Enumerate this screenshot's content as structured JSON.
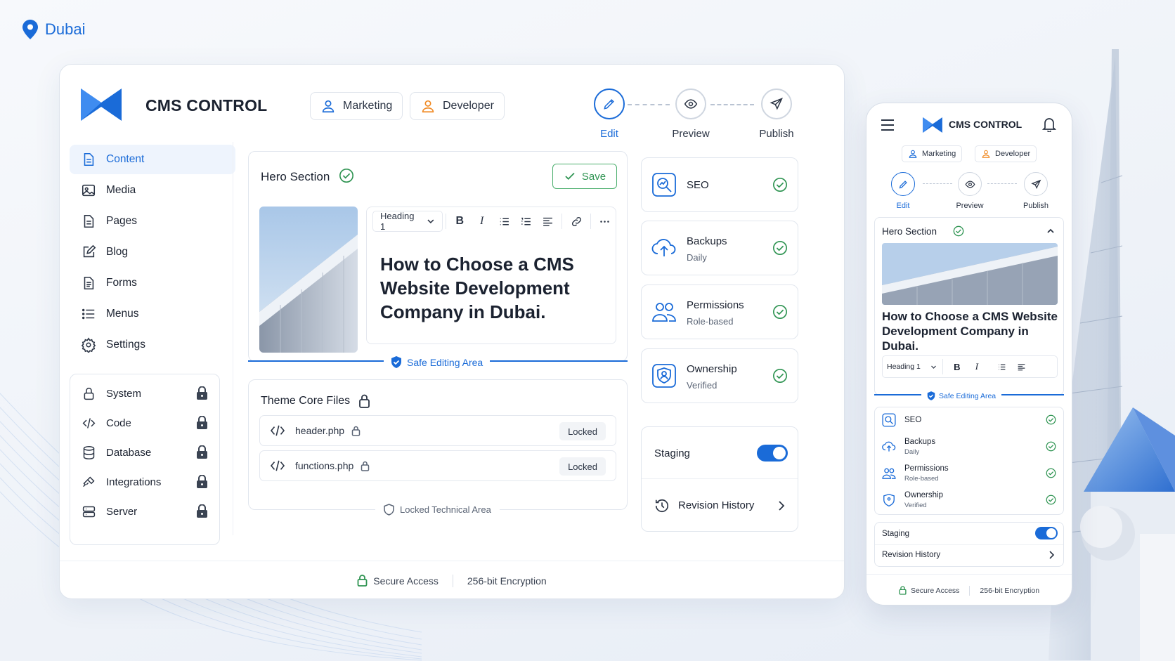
{
  "location": {
    "label": "Dubai"
  },
  "app": {
    "title": "CMS CONTROL"
  },
  "roles": [
    {
      "label": "Marketing"
    },
    {
      "label": "Developer"
    }
  ],
  "steps": [
    {
      "label": "Edit"
    },
    {
      "label": "Preview"
    },
    {
      "label": "Publish"
    }
  ],
  "sidebar": {
    "items": [
      {
        "label": "Content",
        "icon": "document-icon"
      },
      {
        "label": "Media",
        "icon": "image-icon"
      },
      {
        "label": "Pages",
        "icon": "pages-icon"
      },
      {
        "label": "Blog",
        "icon": "edit-icon"
      },
      {
        "label": "Forms",
        "icon": "form-icon"
      },
      {
        "label": "Menus",
        "icon": "list-icon"
      },
      {
        "label": "Settings",
        "icon": "gear-icon"
      }
    ],
    "locked_items": [
      {
        "label": "System"
      },
      {
        "label": "Code"
      },
      {
        "label": "Database"
      },
      {
        "label": "Integrations"
      },
      {
        "label": "Server"
      }
    ]
  },
  "hero": {
    "title": "Hero Section",
    "save_label": "Save",
    "heading_select": "Heading 1",
    "text": "How to Choose a CMS Website Development Company in Dubai.",
    "safe_label": "Safe Editing Area"
  },
  "theme": {
    "title": "Theme Core Files",
    "files": [
      {
        "name": "header.php",
        "status": "Locked"
      },
      {
        "name": "functions.php",
        "status": "Locked"
      }
    ],
    "area_label": "Locked Technical Area"
  },
  "cards": [
    {
      "title": "SEO",
      "subtitle": ""
    },
    {
      "title": "Backups",
      "subtitle": "Daily"
    },
    {
      "title": "Permissions",
      "subtitle": "Role-based"
    },
    {
      "title": "Ownership",
      "subtitle": "Verified"
    }
  ],
  "staging": {
    "label": "Staging",
    "enabled": true
  },
  "revision": {
    "label": "Revision History"
  },
  "footer": {
    "secure": "Secure Access",
    "encryption": "256-bit Encryption"
  },
  "colors": {
    "accent": "#1a6bd8",
    "success": "#2f9452",
    "role_marketing": "#1a6bd8",
    "role_developer": "#f08a24"
  }
}
